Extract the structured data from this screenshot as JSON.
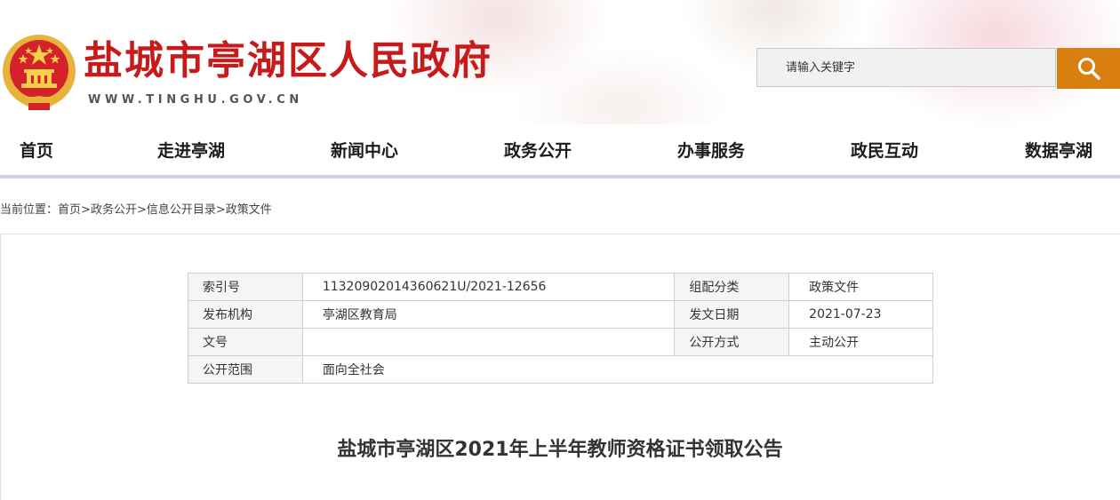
{
  "header": {
    "site_title": "盐城市亭湖区人民政府",
    "site_url": "WWW.TINGHU.GOV.CN",
    "emblem_icon": "national-emblem-icon",
    "search": {
      "placeholder": "请输入关键字",
      "button_icon": "search-icon",
      "button_color": "#d97f0f"
    }
  },
  "nav": {
    "items": [
      {
        "label": "首页"
      },
      {
        "label": "走进亭湖"
      },
      {
        "label": "新闻中心"
      },
      {
        "label": "政务公开"
      },
      {
        "label": "办事服务"
      },
      {
        "label": "政民互动"
      },
      {
        "label": "数据亭湖"
      }
    ]
  },
  "breadcrumb": {
    "prefix": "当前位置：",
    "items": [
      "首页",
      "政务公开",
      "信息公开目录",
      "政策文件"
    ],
    "separator": ">"
  },
  "meta_table": {
    "rows": [
      {
        "label1": "索引号",
        "value1": "11320902014360621U/2021-12656",
        "label2": "组配分类",
        "value2": "政策文件"
      },
      {
        "label1": "发布机构",
        "value1": "亭湖区教育局",
        "label2": "发文日期",
        "value2": "2021-07-23"
      },
      {
        "label1": "文号",
        "value1": "",
        "label2": "公开方式",
        "value2": "主动公开"
      },
      {
        "label1": "公开范围",
        "value1": "面向全社会"
      }
    ]
  },
  "article": {
    "title": "盐城市亭湖区2021年上半年教师资格证书领取公告"
  },
  "colors": {
    "brand_red": "#c71a1a",
    "accent_orange": "#d97f0f",
    "nav_underline": "#cdd5e0"
  }
}
